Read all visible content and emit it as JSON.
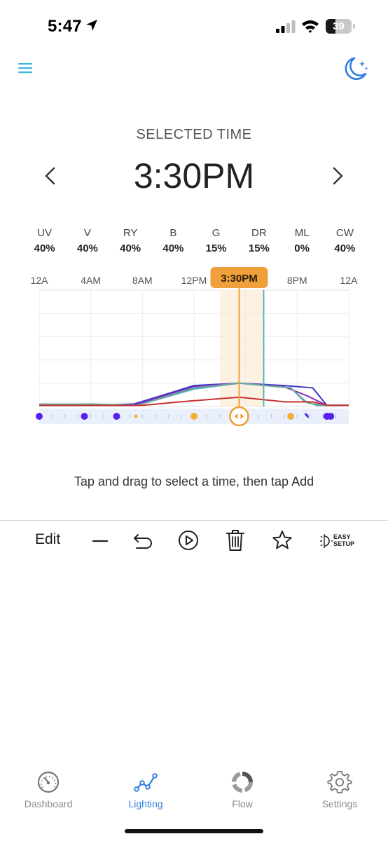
{
  "status_bar": {
    "time": "5:47",
    "battery": "39",
    "battery_level": 0.39
  },
  "header": {
    "label": "SELECTED TIME",
    "time": "3:30PM"
  },
  "channels": [
    {
      "name": "UV",
      "value": "40%"
    },
    {
      "name": "V",
      "value": "40%"
    },
    {
      "name": "RY",
      "value": "40%"
    },
    {
      "name": "B",
      "value": "40%"
    },
    {
      "name": "G",
      "value": "15%"
    },
    {
      "name": "DR",
      "value": "15%"
    },
    {
      "name": "ML",
      "value": "0%"
    },
    {
      "name": "CW",
      "value": "40%"
    }
  ],
  "timeline": {
    "ticks": [
      "12A",
      "4AM",
      "8AM",
      "12PM",
      "8PM",
      "12A"
    ],
    "selected_label": "3:30PM",
    "selected_hour": 15.5,
    "hour_range": [
      0,
      24
    ],
    "marker_hour": 17.4,
    "accent_color": "#f0a03a",
    "grid_rows": 5
  },
  "chart_data": {
    "type": "line",
    "x_unit": "hour of day",
    "xlim": [
      0,
      24
    ],
    "ylim": [
      0,
      100
    ],
    "series": [
      {
        "color": "#3a3ac8",
        "x": [
          0,
          4,
          7.3,
          12,
          15.5,
          19,
          21.2,
          22.3,
          24
        ],
        "y": [
          1,
          1,
          2,
          18,
          20,
          18,
          16,
          1,
          1
        ]
      },
      {
        "color": "#8a2ac0",
        "x": [
          0,
          4,
          7.3,
          12,
          15.5,
          19,
          20.8,
          22.3,
          24
        ],
        "y": [
          1,
          1,
          1,
          17,
          20,
          17,
          9,
          1,
          1
        ]
      },
      {
        "color": "#4aa8c4",
        "x": [
          0,
          4,
          7.6,
          12,
          15.5,
          19.5,
          20.5,
          21.5,
          24
        ],
        "y": [
          1,
          2,
          1,
          15,
          20,
          16,
          5,
          1,
          1
        ]
      },
      {
        "color": "#6aaa9a",
        "x": [
          0,
          4,
          7.6,
          12,
          15.5,
          19.5,
          20.8,
          22,
          24
        ],
        "y": [
          2,
          2,
          1,
          16,
          20,
          16,
          3,
          1,
          1
        ]
      },
      {
        "color": "#c83030",
        "x": [
          0,
          4,
          8,
          12,
          15.5,
          19,
          21.2,
          22.3,
          24
        ],
        "y": [
          1,
          1,
          1,
          5,
          8,
          4,
          4,
          1,
          1
        ]
      }
    ],
    "points": [
      {
        "hour": 0,
        "color": "#5522ee",
        "size": "big"
      },
      {
        "hour": 3.5,
        "color": "#5522ee",
        "size": "big"
      },
      {
        "hour": 6,
        "color": "#5522ee",
        "size": "big"
      },
      {
        "hour": 7.5,
        "color": "#f2b035",
        "size": "small"
      },
      {
        "hour": 12,
        "color": "#f2b035",
        "size": "big"
      },
      {
        "hour": 19.5,
        "color": "#f2b035",
        "size": "big"
      },
      {
        "hour": 20.7,
        "color": "#5522ee",
        "size": "partial"
      },
      {
        "hour": 22.3,
        "color": "#5522ee",
        "size": "big"
      },
      {
        "hour": 22.6,
        "color": "#5522ee",
        "size": "big"
      }
    ]
  },
  "hint": "Tap and drag to select a time, then tap Add",
  "toolbar": {
    "edit_label": "Edit",
    "easy_line1": "EASY",
    "easy_line2": "SETUP",
    "icons": [
      "minus-icon",
      "undo-icon",
      "play-icon",
      "trash-icon",
      "star-icon",
      "easy-setup-icon"
    ]
  },
  "nav": [
    {
      "label": "Dashboard",
      "icon": "gauge-icon",
      "active": false
    },
    {
      "label": "Lighting",
      "icon": "chart-line-icon",
      "active": true
    },
    {
      "label": "Flow",
      "icon": "flow-ring-icon",
      "active": false
    },
    {
      "label": "Settings",
      "icon": "gear-icon",
      "active": false
    }
  ],
  "colors": {
    "accent": "#2f7ee0",
    "menu": "#3ab7d6",
    "selection": "#f0a03a"
  }
}
